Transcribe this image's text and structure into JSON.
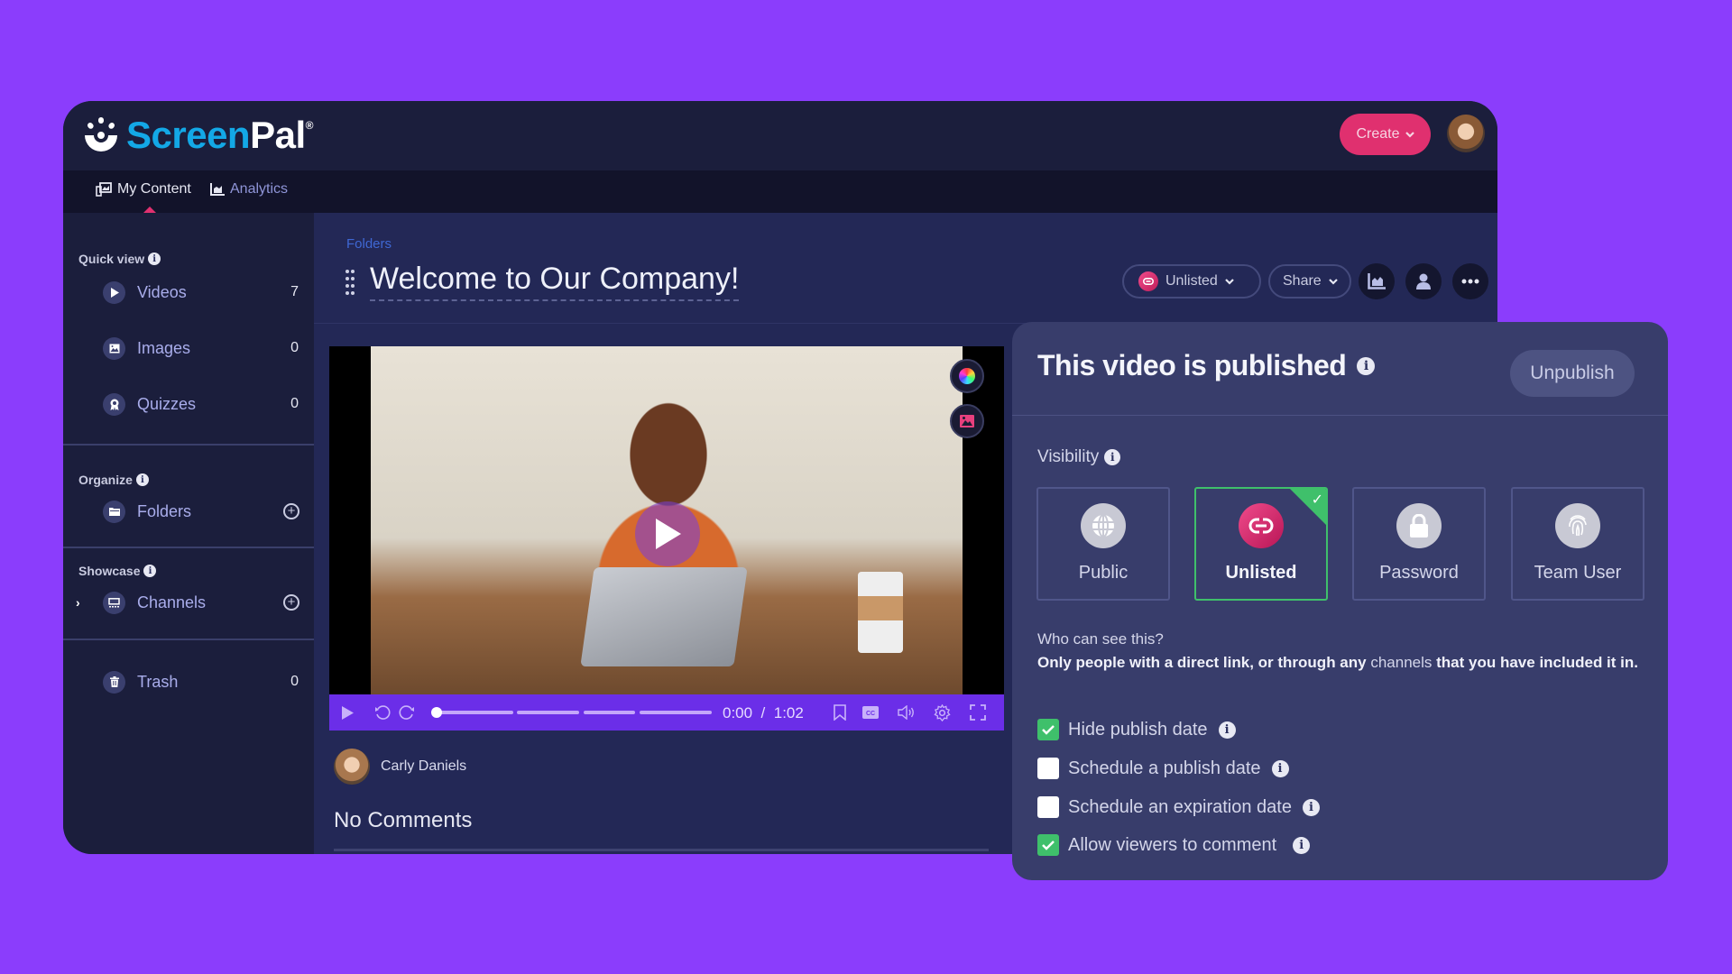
{
  "app": {
    "brand_part1": "Screen",
    "brand_part2": "Pal",
    "brand_mark": "®",
    "create_label": "Create",
    "user_avatar_alt": "User avatar"
  },
  "nav": {
    "items": [
      {
        "label": "My Content",
        "icon": "my-content-icon",
        "active": true
      },
      {
        "label": "Analytics",
        "icon": "analytics-icon",
        "active": false
      }
    ]
  },
  "sidebar": {
    "quick_view_title": "Quick view",
    "quick_view": [
      {
        "label": "Videos",
        "count": "7",
        "icon": "play-icon"
      },
      {
        "label": "Images",
        "count": "0",
        "icon": "image-icon"
      },
      {
        "label": "Quizzes",
        "count": "0",
        "icon": "award-icon"
      }
    ],
    "organize_title": "Organize",
    "folders_label": "Folders",
    "showcase_title": "Showcase",
    "channels_label": "Channels",
    "trash_label": "Trash",
    "trash_count": "0"
  },
  "content": {
    "breadcrumb": "Folders",
    "title": "Welcome to Our Company!",
    "visibility_pill": "Unlisted",
    "share_label": "Share"
  },
  "player": {
    "current_time": "0:00",
    "separator": "/",
    "duration": "1:02",
    "progress": 0
  },
  "author": {
    "name": "Carly Daniels"
  },
  "comments": {
    "label": "No Comments"
  },
  "publish_panel": {
    "title": "This video is published",
    "unpublish_label": "Unpublish",
    "visibility_label": "Visibility",
    "options": [
      {
        "label": "Public",
        "icon": "globe-icon",
        "selected": false
      },
      {
        "label": "Unlisted",
        "icon": "link-icon",
        "selected": true
      },
      {
        "label": "Password",
        "icon": "lock-icon",
        "selected": false
      },
      {
        "label": "Team User",
        "icon": "fingerprint-icon",
        "selected": false
      }
    ],
    "who_question": "Who can see this?",
    "who_answer_part1": "Only people with a direct link, or through any",
    "who_answer_link": "channels",
    "who_answer_part2": "that you have included it in.",
    "settings": [
      {
        "label": "Hide publish date",
        "checked": true
      },
      {
        "label": "Schedule a publish date",
        "checked": false
      },
      {
        "label": "Schedule an expiration date",
        "checked": false
      },
      {
        "label": "Allow viewers to comment",
        "checked": true
      }
    ]
  },
  "colors": {
    "background": "#8b3dfc",
    "accent_pink": "#e0306f",
    "brand_blue": "#13a8e6",
    "player_bar": "#6b2ee8",
    "selected_green": "#3fc06b"
  }
}
